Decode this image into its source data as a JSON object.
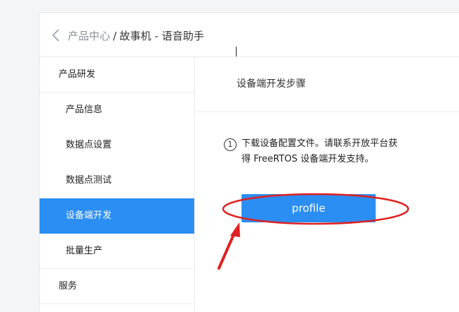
{
  "header": {
    "back_icon": "chevron-left-icon",
    "breadcrumb": {
      "parent": "产品中心",
      "separator": "/",
      "current": "故事机 - 语音助手"
    }
  },
  "sidebar": {
    "items": [
      {
        "label": "产品研发",
        "kind": "group"
      },
      {
        "label": "产品信息",
        "kind": "child"
      },
      {
        "label": "数据点设置",
        "kind": "child"
      },
      {
        "label": "数据点测试",
        "kind": "child"
      },
      {
        "label": "设备端开发",
        "kind": "child",
        "active": true
      },
      {
        "label": "批量生产",
        "kind": "child"
      },
      {
        "label": "服务",
        "kind": "group"
      }
    ]
  },
  "main": {
    "title": "设备端开发步骤",
    "step": {
      "number": "1",
      "line1": "下载设备配置文件。请联系开放平台获",
      "line2": "得 FreeRTOS 设备端开发支持。"
    },
    "button_label": "profile"
  },
  "colors": {
    "accent": "#2b8ef3",
    "annotation": "#e02020"
  }
}
